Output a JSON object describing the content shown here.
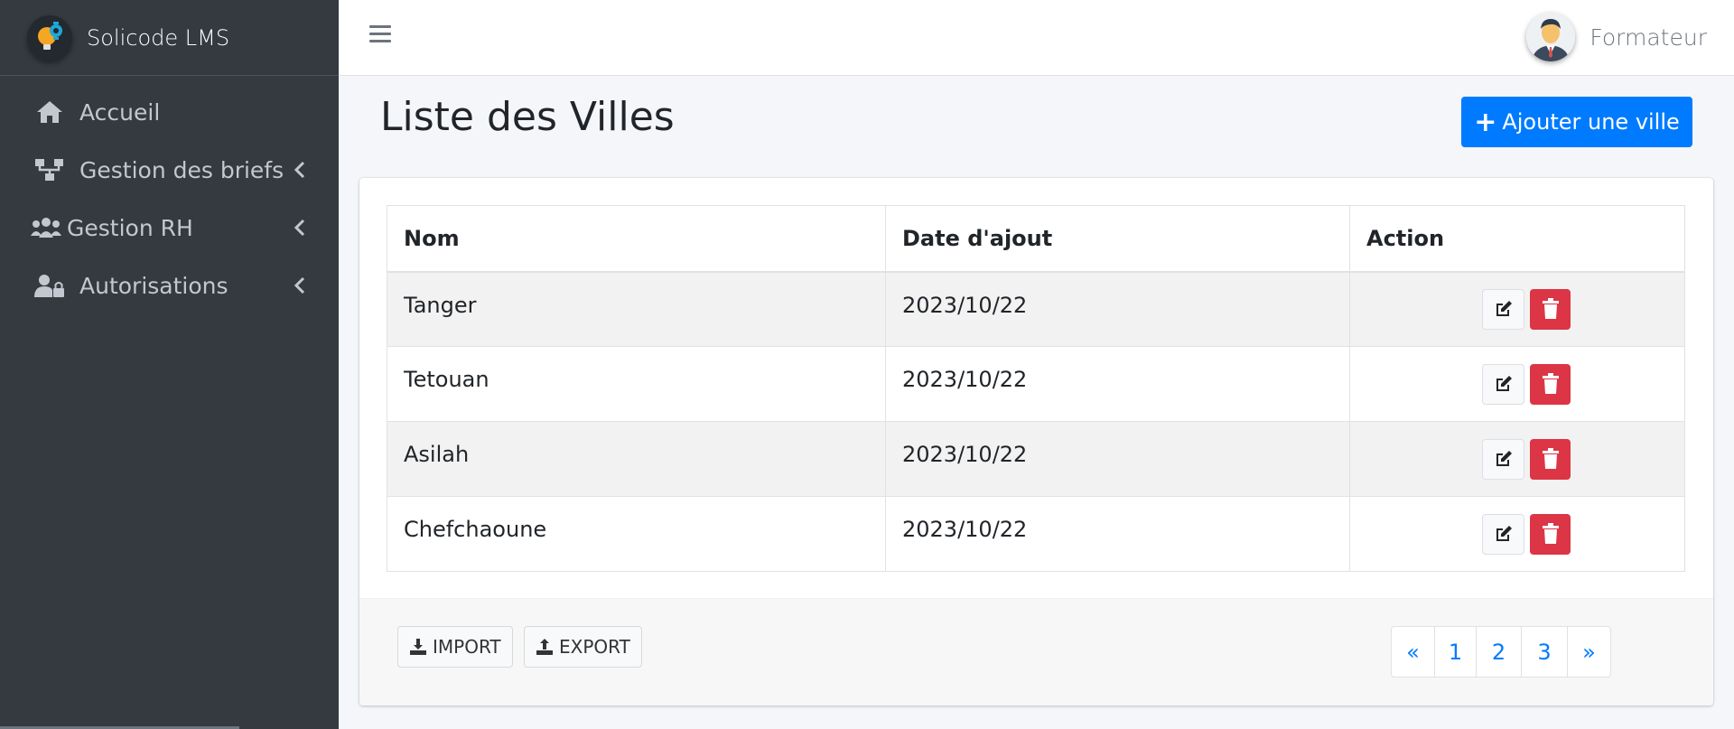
{
  "app": {
    "brand": "Solicode LMS"
  },
  "sidebar": {
    "items": [
      {
        "label": "Accueil",
        "icon": "home-icon"
      },
      {
        "label": "Gestion des briefs",
        "icon": "sitemap-icon"
      },
      {
        "label": "Gestion RH",
        "icon": "users-icon"
      },
      {
        "label": "Autorisations",
        "icon": "user-lock-icon"
      }
    ]
  },
  "header": {
    "user_name": "Formateur"
  },
  "main": {
    "title": "Liste des Villes",
    "add_button": "Ajouter une ville",
    "table": {
      "columns": [
        "Nom",
        "Date d'ajout",
        "Action"
      ],
      "rows": [
        {
          "nom": "Tanger",
          "date": "2023/10/22"
        },
        {
          "nom": "Tetouan",
          "date": "2023/10/22"
        },
        {
          "nom": "Asilah",
          "date": "2023/10/22"
        },
        {
          "nom": "Chefchaoune",
          "date": "2023/10/22"
        }
      ]
    },
    "footer": {
      "import_label": "IMPORT",
      "export_label": "EXPORT",
      "pagination": [
        "«",
        "1",
        "2",
        "3",
        "»"
      ]
    }
  },
  "colors": {
    "sidebar_bg": "#343a40",
    "primary": "#007bff",
    "danger": "#dc3545",
    "page_bg": "#f4f6f9"
  }
}
